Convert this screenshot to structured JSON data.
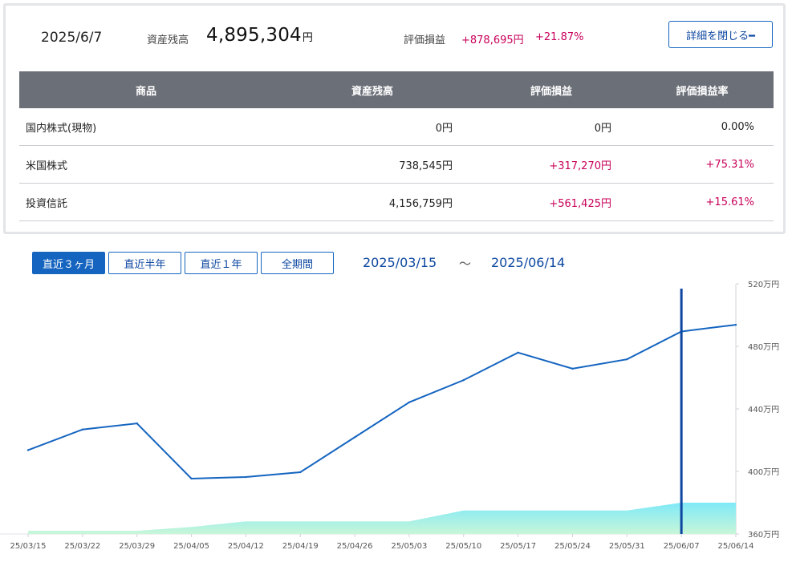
{
  "summary": {
    "date": "2025/6/7",
    "balance_label": "資産残高",
    "balance_value": "4,895,304",
    "balance_unit": "円",
    "pl_label": "評価損益",
    "pl_value": "+878,695円",
    "pl_rate": "+21.87%",
    "detail_button": "詳細を閉じる━"
  },
  "table": {
    "headers": [
      "商品",
      "資産残高",
      "評価損益",
      "評価損益率"
    ],
    "rows": [
      {
        "name": "国内株式(現物)",
        "balance": "0円",
        "pl": "0円",
        "rate": "0.00%"
      },
      {
        "name": "米国株式",
        "balance": "738,545円",
        "pl": "+317,270円",
        "rate": "+75.31%"
      },
      {
        "name": "投資信託",
        "balance": "4,156,759円",
        "pl": "+561,425円",
        "rate": "+15.61%"
      }
    ]
  },
  "range": {
    "buttons": [
      "直近３ヶ月",
      "直近半年",
      "直近１年",
      "全期間"
    ],
    "active_index": 0,
    "start": "2025/03/15",
    "separator": "～",
    "end": "2025/06/14"
  },
  "chart_data": {
    "type": "line",
    "x": [
      "25/03/15",
      "25/03/22",
      "25/03/29",
      "25/04/05",
      "25/04/12",
      "25/04/19",
      "25/04/26",
      "25/05/03",
      "25/05/10",
      "25/05/17",
      "25/05/24",
      "25/05/31",
      "25/06/07",
      "25/06/14"
    ],
    "series": [
      {
        "kind": "line",
        "values": [
          413.6,
          426.8,
          430.7,
          395.4,
          396.4,
          399.5,
          null,
          444.2,
          458.4,
          476.0,
          465.7,
          471.7,
          489.5,
          493.8
        ]
      },
      {
        "kind": "area",
        "values": [
          362,
          362,
          362,
          364.5,
          368,
          368,
          368,
          368,
          375,
          375,
          375,
          375,
          380,
          380
        ]
      }
    ],
    "y_ticks": [
      "520万円",
      "480万円",
      "440万円",
      "400万円",
      "360万円"
    ],
    "ylim": [
      360,
      520
    ],
    "selected_x": "25/06/07",
    "colors": {
      "line": "#1565c0",
      "area_top": "#7fe9f8",
      "area_bottom": "#c8f6d8",
      "marker": "#0d47a1"
    }
  }
}
